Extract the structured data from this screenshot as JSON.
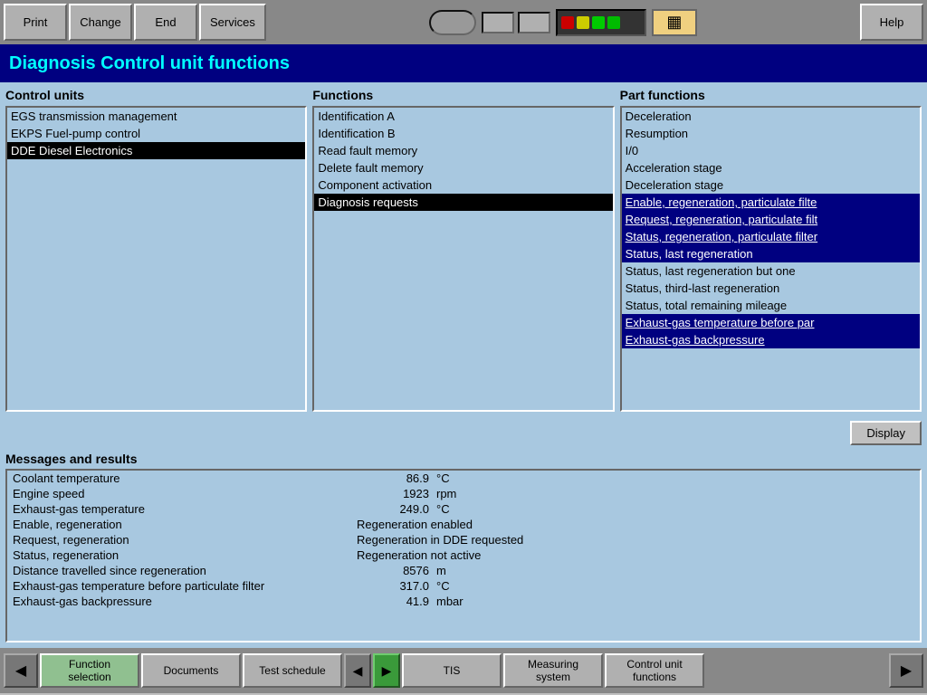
{
  "toolbar": {
    "print_label": "Print",
    "change_label": "Change",
    "end_label": "End",
    "services_label": "Services",
    "help_label": "Help"
  },
  "title": "Diagnosis  Control unit functions",
  "control_units": {
    "header": "Control units",
    "items": [
      {
        "label": "EGS transmission management",
        "selected": false
      },
      {
        "label": "EKPS Fuel-pump control",
        "selected": false
      },
      {
        "label": "DDE Diesel Electronics",
        "selected": true
      }
    ]
  },
  "functions": {
    "header": "Functions",
    "items": [
      {
        "label": "Identification A",
        "selected": false
      },
      {
        "label": "Identification B",
        "selected": false
      },
      {
        "label": "Read fault memory",
        "selected": false
      },
      {
        "label": "Delete fault memory",
        "selected": false
      },
      {
        "label": "Component activation",
        "selected": false
      },
      {
        "label": "Diagnosis requests",
        "selected": true
      }
    ]
  },
  "part_functions": {
    "header": "Part functions",
    "items": [
      {
        "label": "Deceleration",
        "selected": false
      },
      {
        "label": "Resumption",
        "selected": false
      },
      {
        "label": "I/0",
        "selected": false
      },
      {
        "label": "Acceleration stage",
        "selected": false
      },
      {
        "label": "Deceleration stage",
        "selected": false
      },
      {
        "label": "Enable, regeneration, particulate filte",
        "selected": true,
        "underline": true
      },
      {
        "label": "Request, regeneration, particulate filt",
        "selected": true,
        "underline": true
      },
      {
        "label": "Status, regeneration, particulate filter",
        "selected": true,
        "underline": true
      },
      {
        "label": "Status, last regeneration",
        "selected": true
      },
      {
        "label": "Status, last regeneration but one",
        "selected": false
      },
      {
        "label": "Status, third-last regeneration",
        "selected": false
      },
      {
        "label": "Status, total remaining mileage",
        "selected": false
      },
      {
        "label": "Exhaust-gas temperature before par",
        "selected": true,
        "underline": true
      },
      {
        "label": "Exhaust-gas backpressure",
        "selected": true,
        "underline": true
      }
    ]
  },
  "display_btn": "Display",
  "messages": {
    "header": "Messages and results",
    "rows": [
      {
        "label": "Coolant temperature",
        "value": "86.9",
        "unit": "°C",
        "text": ""
      },
      {
        "label": "Engine speed",
        "value": "1923",
        "unit": "rpm",
        "text": ""
      },
      {
        "label": "Exhaust-gas temperature",
        "value": "249.0",
        "unit": "°C",
        "text": ""
      },
      {
        "label": "Enable, regeneration",
        "value": "",
        "unit": "",
        "text": "Regeneration enabled"
      },
      {
        "label": "Request, regeneration",
        "value": "",
        "unit": "",
        "text": "Regeneration in DDE requested"
      },
      {
        "label": "Status, regeneration",
        "value": "",
        "unit": "",
        "text": "Regeneration not active"
      },
      {
        "label": "Distance travelled since regeneration",
        "value": "8576",
        "unit": "m",
        "text": ""
      },
      {
        "label": "Exhaust-gas temperature before particulate filter",
        "value": "317.0",
        "unit": "°C",
        "text": ""
      },
      {
        "label": "Exhaust-gas backpressure",
        "value": "41.9",
        "unit": "mbar",
        "text": ""
      }
    ]
  },
  "bottom_nav": {
    "items": [
      {
        "label": "Function\nselection",
        "active": true
      },
      {
        "label": "Documents",
        "active": false
      },
      {
        "label": "Test schedule",
        "active": false
      },
      {
        "label": "TIS",
        "active": false
      },
      {
        "label": "Measuring\nsystem",
        "active": false
      },
      {
        "label": "Control unit\nfunctions",
        "active": false
      }
    ]
  }
}
